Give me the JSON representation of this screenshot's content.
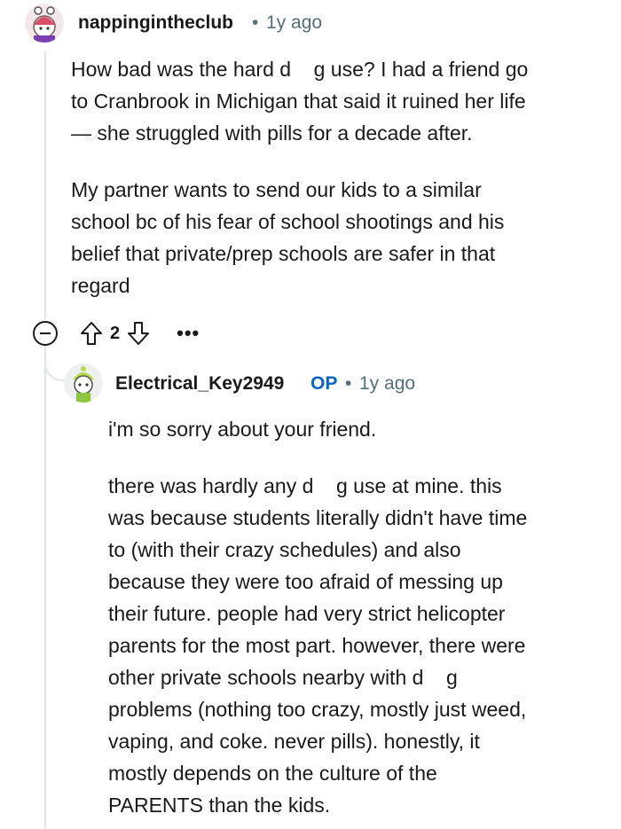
{
  "comment": {
    "username": "nappingintheclub",
    "separator": "•",
    "age": "1y ago",
    "paragraphs": [
      "How bad was the hard d  g use? I had a friend go\nto Cranbrook in Michigan that said it ruined her life\n— she struggled with pills for a decade after.",
      "My partner wants to send our kids to a similar\nschool bc of his fear of school shootings and his\nbelief that private/prep schools are safer in that\nregard"
    ],
    "vote_count": "2"
  },
  "reply": {
    "username": "Electrical_Key2949",
    "op_badge": "OP",
    "separator": "•",
    "age": "1y ago",
    "paragraphs": [
      "i'm so sorry about your friend.",
      "there was hardly any d  g use at mine. this\nwas because students literally didn't have time\nto (with their crazy schedules) and also\nbecause they were too afraid of messing up\ntheir future. people had very strict helicopter\nparents for the most part. however, there were\nother private schools nearby with d  g\nproblems (nothing too crazy, mostly just weed,\nvaping, and coke. never pills). honestly, it\nmostly depends on the culture of the\nPARENTS than the kids."
    ]
  },
  "icons": {
    "collapse": "collapse-icon",
    "upvote": "upvote-icon",
    "downvote": "downvote-icon",
    "more": "more-options-icon"
  },
  "colors": {
    "text": "#1a1a1b",
    "meta": "#576f76",
    "op_badge": "#0a66c2",
    "thread_line": "#e3e6e8"
  }
}
